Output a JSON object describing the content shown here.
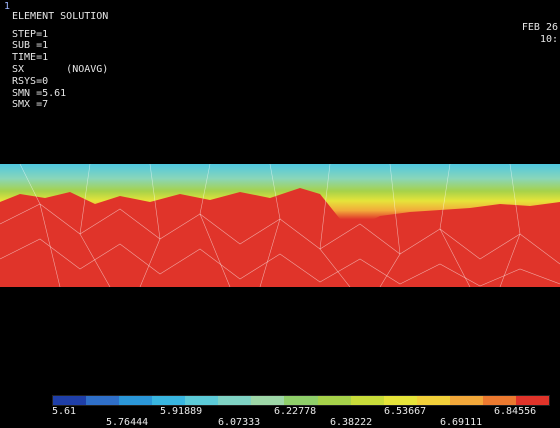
{
  "window_number": "1",
  "header": {
    "title": "ELEMENT SOLUTION",
    "lines": [
      "STEP=1",
      "SUB =1",
      "TIME=1",
      "SX       (NOAVG)",
      "RSYS=0",
      "SMN =5.61",
      "SMX =7"
    ],
    "date": "FEB 26",
    "time": "10:"
  },
  "legend": {
    "colors": [
      "#1f3fa8",
      "#2f6fc8",
      "#2b97d8",
      "#39b6e0",
      "#5ccbd8",
      "#7fd3c4",
      "#9ed7a8",
      "#8fcf6a",
      "#a6d24a",
      "#c8dc3a",
      "#e6e43a",
      "#f2d03a",
      "#f2a83a",
      "#ec7a30",
      "#e0342a"
    ],
    "ticks": [
      "5.61",
      "5.91889",
      "6.22778",
      "6.53667",
      "6.84556"
    ],
    "ticks_lower": [
      "5.76444",
      "6.07333",
      "6.38222",
      "6.69111"
    ]
  }
}
